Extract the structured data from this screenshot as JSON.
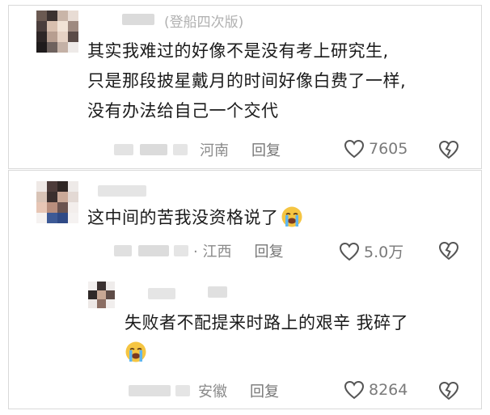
{
  "comments": [
    {
      "edition_tag": "(登船四次版)",
      "lines": [
        "其实我难过的好像不是没有考上研究生,",
        "只是那段披星戴月的时间好像白费了一样,",
        "没有办法给自己一个交代"
      ],
      "location": "河南",
      "reply_label": "回复",
      "likes": "7605"
    },
    {
      "lines": [
        "这中间的苦我没资格说了"
      ],
      "location": "· 江西",
      "reply_label": "回复",
      "likes": "5.0万"
    },
    {
      "lines": [
        "失败者不配提来时路上的艰辛 我碎了"
      ],
      "location": "安徽",
      "reply_label": "回复",
      "likes": "8264"
    }
  ],
  "icons": {
    "like": "heart-outline-icon",
    "dislike": "broken-heart-outline-icon",
    "emoji": "loudly-crying-face-emoji"
  },
  "colors": {
    "text": "#1b1b1b",
    "meta": "#8a8a8a",
    "border": "#d9d9d9",
    "emoji": "#f5c542"
  }
}
